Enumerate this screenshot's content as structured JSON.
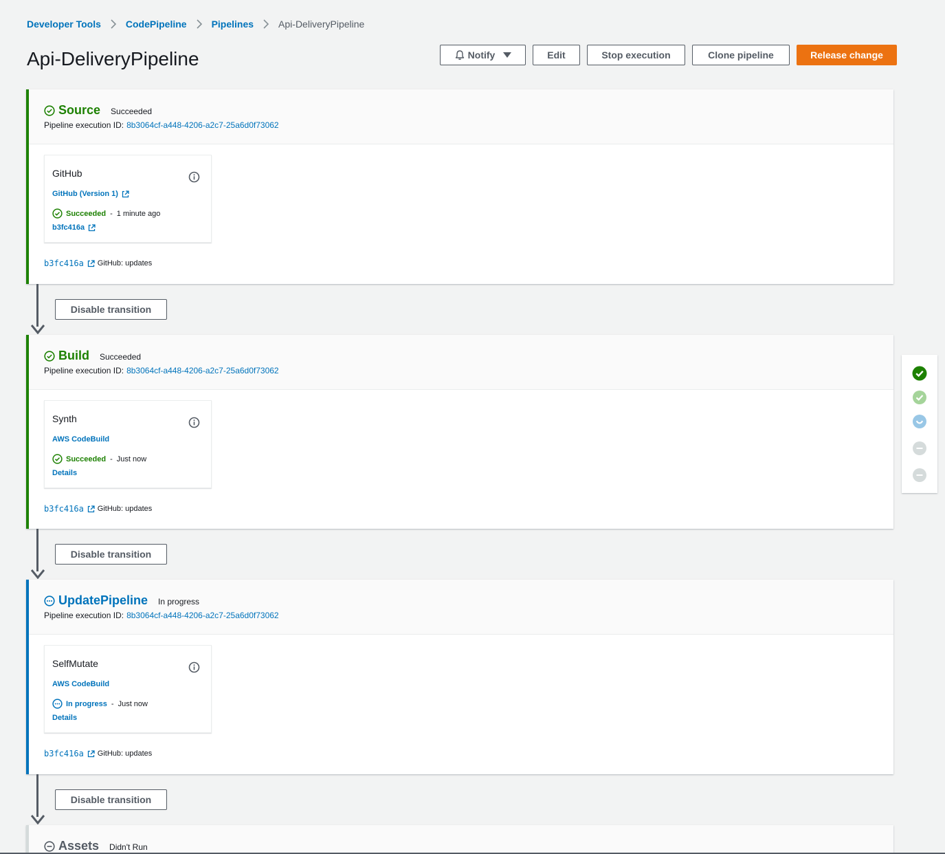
{
  "breadcrumb": [
    {
      "label": "Developer Tools"
    },
    {
      "label": "CodePipeline"
    },
    {
      "label": "Pipelines"
    },
    {
      "label": "Api-DeliveryPipeline"
    }
  ],
  "page_title": "Api-DeliveryPipeline",
  "toolbar": {
    "notify_label": "Notify",
    "edit_label": "Edit",
    "stop_label": "Stop execution",
    "clone_label": "Clone pipeline",
    "release_label": "Release change"
  },
  "colors": {
    "success": "#1d8102",
    "progress": "#0073bb",
    "primary": "#ec7211",
    "muted": "#545b64"
  },
  "stages": [
    {
      "name": "Source",
      "status": "Succeeded",
      "exec_label": "Pipeline execution ID:",
      "exec_id": "8b3064cf-a448-4206-a2c7-25a6d0f73062",
      "action": {
        "name": "GitHub",
        "provider": "GitHub (Version 1)",
        "status": "Succeeded",
        "time": "1 minute ago",
        "link": "b3fc416a"
      },
      "commit": "b3fc416a",
      "commit_msg": "GitHub: updates"
    },
    {
      "name": "Build",
      "status": "Succeeded",
      "exec_label": "Pipeline execution ID:",
      "exec_id": "8b3064cf-a448-4206-a2c7-25a6d0f73062",
      "action": {
        "name": "Synth",
        "provider": "AWS CodeBuild",
        "status": "Succeeded",
        "time": "Just now",
        "link": "Details"
      },
      "commit": "b3fc416a",
      "commit_msg": "GitHub: updates"
    },
    {
      "name": "UpdatePipeline",
      "status": "In progress",
      "exec_label": "Pipeline execution ID:",
      "exec_id": "8b3064cf-a448-4206-a2c7-25a6d0f73062",
      "action": {
        "name": "SelfMutate",
        "provider": "AWS CodeBuild",
        "status": "In progress",
        "time": "Just now",
        "link": "Details"
      },
      "commit": "b3fc416a",
      "commit_msg": "GitHub: updates"
    },
    {
      "name": "Assets",
      "status": "Didn't Run"
    }
  ],
  "transition_label": "Disable transition",
  "progress_rail": [
    "succeeded",
    "succeeded",
    "in-progress",
    "not-run",
    "not-run"
  ]
}
